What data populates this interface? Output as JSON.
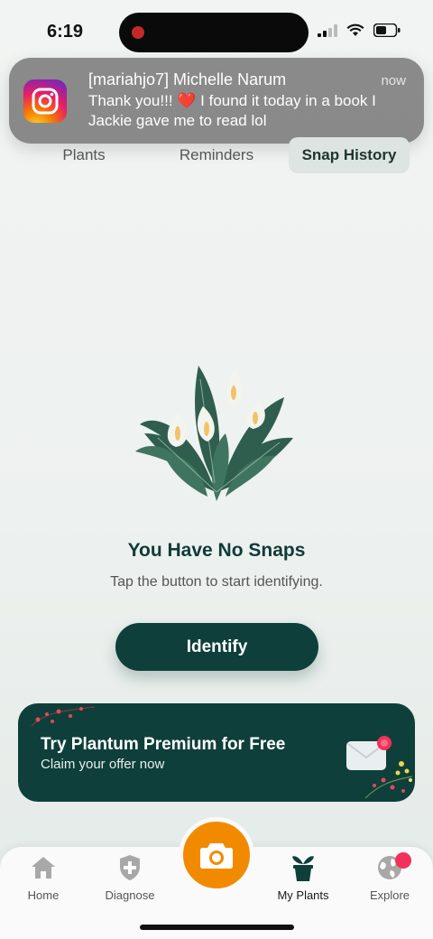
{
  "status_bar": {
    "time": "6:19"
  },
  "notification": {
    "app": "Instagram",
    "title": "[mariahjo7] Michelle Narum",
    "time": "now",
    "body": "Thank you!!! ❤️ I found it today in a book I Jackie gave me to read lol"
  },
  "tabs": [
    "Plants",
    "Reminders",
    "Snap History"
  ],
  "active_tab": "Snap History",
  "empty_state": {
    "title": "You Have No Snaps",
    "subtitle": "Tap the button to start identifying.",
    "button": "Identify"
  },
  "premium_banner": {
    "title": "Try Plantum Premium for Free",
    "subtitle": "Claim your offer now"
  },
  "bottom_nav": {
    "items": [
      {
        "label": "Home",
        "icon": "home-icon"
      },
      {
        "label": "Diagnose",
        "icon": "shield-plus-icon"
      },
      {
        "label": "My Plants",
        "icon": "plant-pot-icon"
      },
      {
        "label": "Explore",
        "icon": "globe-icon"
      }
    ],
    "active": "My Plants",
    "camera_icon": "camera-icon"
  },
  "colors": {
    "primary": "#0f3f3b",
    "accent": "#f28a00",
    "badge": "#f2325a"
  }
}
